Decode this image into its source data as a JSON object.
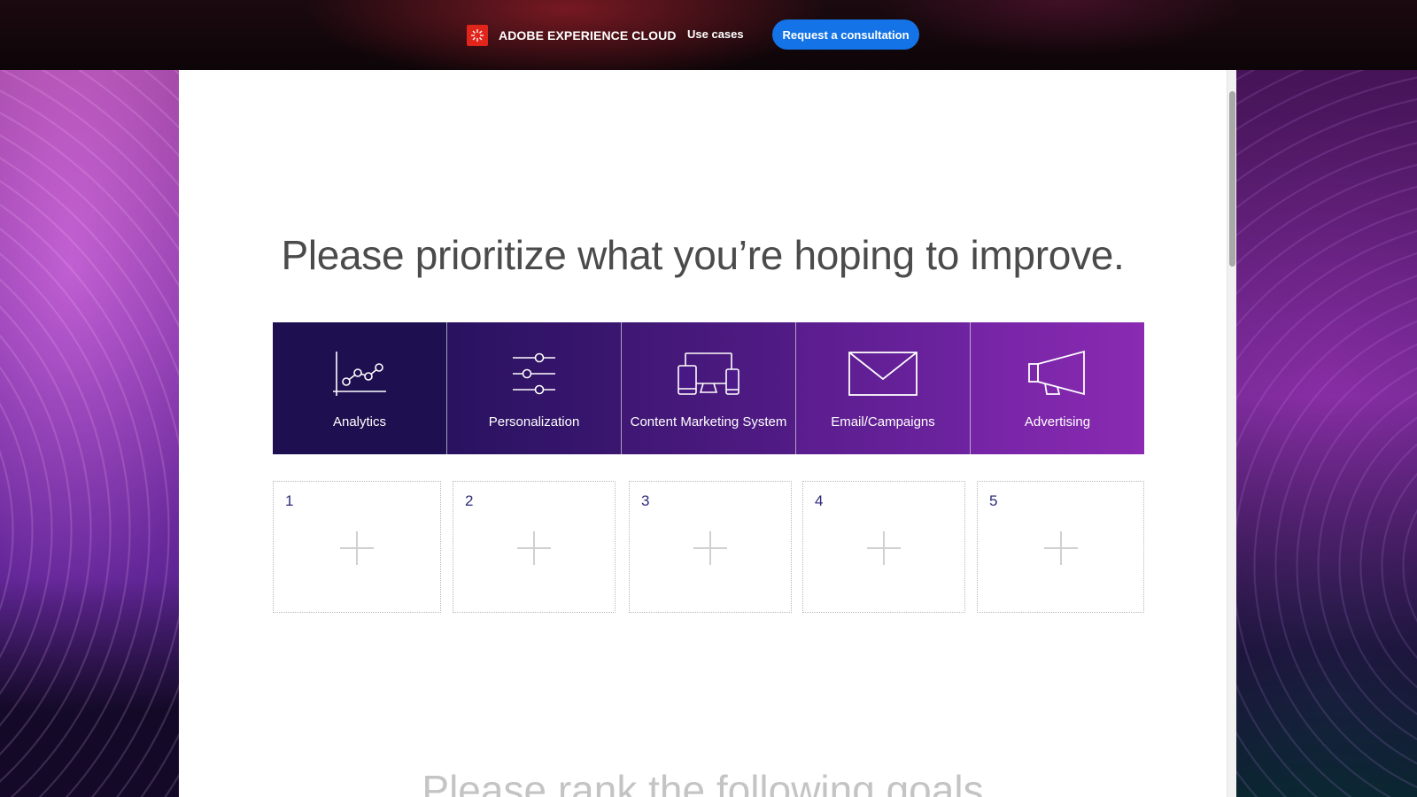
{
  "nav": {
    "brand": "ADOBE EXPERIENCE CLOUD",
    "use_cases": "Use cases",
    "cta": "Request a consultation",
    "cta_color": "#1473e6",
    "logo_color": "#e1251b"
  },
  "main": {
    "heading": "Please prioritize what you’re hoping to improve.",
    "next_heading": "Please rank the following goals",
    "categories": [
      {
        "label": "Analytics",
        "icon": "analytics-chart-icon"
      },
      {
        "label": "Personalization",
        "icon": "sliders-icon"
      },
      {
        "label": "Content Marketing System",
        "icon": "devices-icon"
      },
      {
        "label": "Email/Campaigns",
        "icon": "envelope-icon"
      },
      {
        "label": "Advertising",
        "icon": "megaphone-icon"
      }
    ],
    "slots": [
      {
        "number": "1"
      },
      {
        "number": "2"
      },
      {
        "number": "3"
      },
      {
        "number": "4"
      },
      {
        "number": "5"
      }
    ]
  }
}
